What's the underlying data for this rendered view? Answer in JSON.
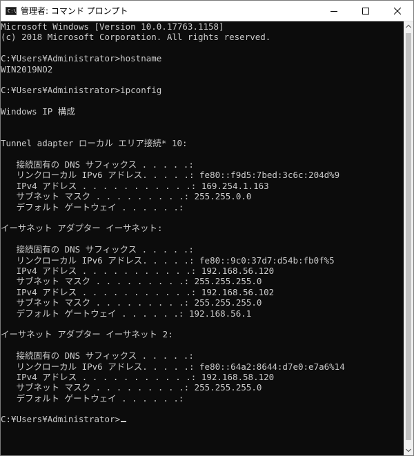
{
  "window": {
    "title": "管理者: コマンド プロンプト",
    "icon_label": "C:\\"
  },
  "terminal": {
    "lines": [
      "Microsoft Windows [Version 10.0.17763.1158]",
      "(c) 2018 Microsoft Corporation. All rights reserved.",
      "",
      "C:¥Users¥Administrator>hostname",
      "WIN2019NO2",
      "",
      "C:¥Users¥Administrator>ipconfig",
      "",
      "Windows IP 構成",
      "",
      "",
      "Tunnel adapter ローカル エリア接続* 10:",
      "",
      "   接続固有の DNS サフィックス . . . . .:",
      "   リンクローカル IPv6 アドレス. . . . .: fe80::f9d5:7bed:3c6c:204d%9",
      "   IPv4 アドレス . . . . . . . . . . .: 169.254.1.163",
      "   サブネット マスク . . . . . . . . .: 255.255.0.0",
      "   デフォルト ゲートウェイ . . . . . .:",
      "",
      "イーサネット アダプター イーサネット:",
      "",
      "   接続固有の DNS サフィックス . . . . .:",
      "   リンクローカル IPv6 アドレス. . . . .: fe80::9c0:37d7:d54b:fb0f%5",
      "   IPv4 アドレス . . . . . . . . . . .: 192.168.56.120",
      "   サブネット マスク . . . . . . . . .: 255.255.255.0",
      "   IPv4 アドレス . . . . . . . . . . .: 192.168.56.102",
      "   サブネット マスク . . . . . . . . .: 255.255.255.0",
      "   デフォルト ゲートウェイ . . . . . .: 192.168.56.1",
      "",
      "イーサネット アダプター イーサネット 2:",
      "",
      "   接続固有の DNS サフィックス . . . . .:",
      "   リンクローカル IPv6 アドレス. . . . .: fe80::64a2:8644:d7e0:e7a6%14",
      "   IPv4 アドレス . . . . . . . . . . .: 192.168.58.120",
      "   サブネット マスク . . . . . . . . .: 255.255.255.0",
      "   デフォルト ゲートウェイ . . . . . .:",
      "",
      "C:¥Users¥Administrator>"
    ]
  },
  "colors": {
    "terminal_bg": "#0c0c0c",
    "terminal_fg": "#cccccc",
    "titlebar_bg": "#ffffff"
  },
  "icons": {
    "minimize": "minimize-icon",
    "maximize": "maximize-icon",
    "close": "close-icon"
  }
}
